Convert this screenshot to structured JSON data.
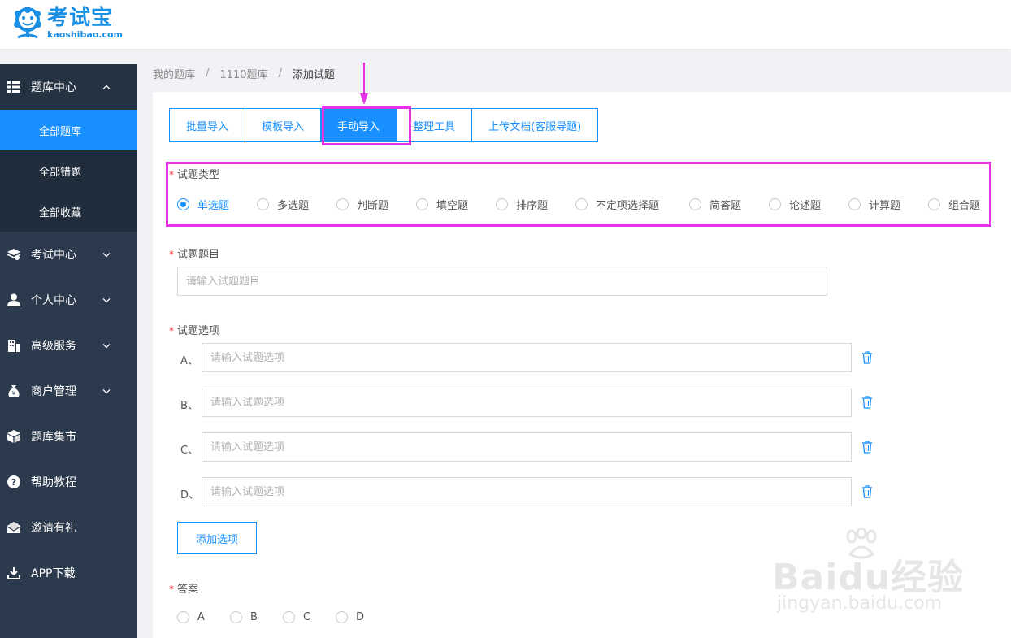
{
  "brand": {
    "name_cn": "考试宝",
    "name_en": "kaoshibao.com"
  },
  "sidebar": {
    "items": [
      {
        "label": "题库中心",
        "icon": "list-icon",
        "expanded": true,
        "children": [
          "全部题库",
          "全部错题",
          "全部收藏"
        ],
        "active_child": "全部题库"
      },
      {
        "label": "考试中心",
        "icon": "layers-icon"
      },
      {
        "label": "个人中心",
        "icon": "user-icon"
      },
      {
        "label": "高级服务",
        "icon": "building-icon"
      },
      {
        "label": "商户管理",
        "icon": "money-bag-icon"
      },
      {
        "label": "题库集市",
        "icon": "cube-icon"
      },
      {
        "label": "帮助教程",
        "icon": "help-icon"
      },
      {
        "label": "邀请有礼",
        "icon": "envelope-icon"
      },
      {
        "label": "APP下载",
        "icon": "download-icon"
      }
    ]
  },
  "breadcrumb": [
    "我的题库",
    "1110题库",
    "添加试题"
  ],
  "tabs": {
    "items": [
      "批量导入",
      "模板导入",
      "手动导入",
      "整理工具",
      "上传文档(客服导题)"
    ],
    "active": "手动导入"
  },
  "form": {
    "required_mark": "*",
    "question_type": {
      "label": "试题类型",
      "options": [
        "单选题",
        "多选题",
        "判断题",
        "填空题",
        "排序题",
        "不定项选择题",
        "简答题",
        "论述题",
        "计算题",
        "组合题"
      ],
      "selected": "单选题"
    },
    "question_title": {
      "label": "试题题目",
      "placeholder": "请输入试题题目",
      "value": ""
    },
    "question_options": {
      "label": "试题选项",
      "items": [
        {
          "letter": "A、",
          "placeholder": "请输入试题选项",
          "value": ""
        },
        {
          "letter": "B、",
          "placeholder": "请输入试题选项",
          "value": ""
        },
        {
          "letter": "C、",
          "placeholder": "请输入试题选项",
          "value": ""
        },
        {
          "letter": "D、",
          "placeholder": "请输入试题选项",
          "value": ""
        }
      ],
      "add_label": "添加选项"
    },
    "answer": {
      "label": "答案",
      "options": [
        "A",
        "B",
        "C",
        "D"
      ],
      "selected": null
    }
  },
  "watermark": {
    "main": "Baidu经验",
    "sub": "jingyan.baidu.com"
  },
  "colors": {
    "primary": "#1890ff",
    "sidebar_bg": "#2c3a4d",
    "highlight": "#e631e6",
    "required": "#f5222d"
  }
}
